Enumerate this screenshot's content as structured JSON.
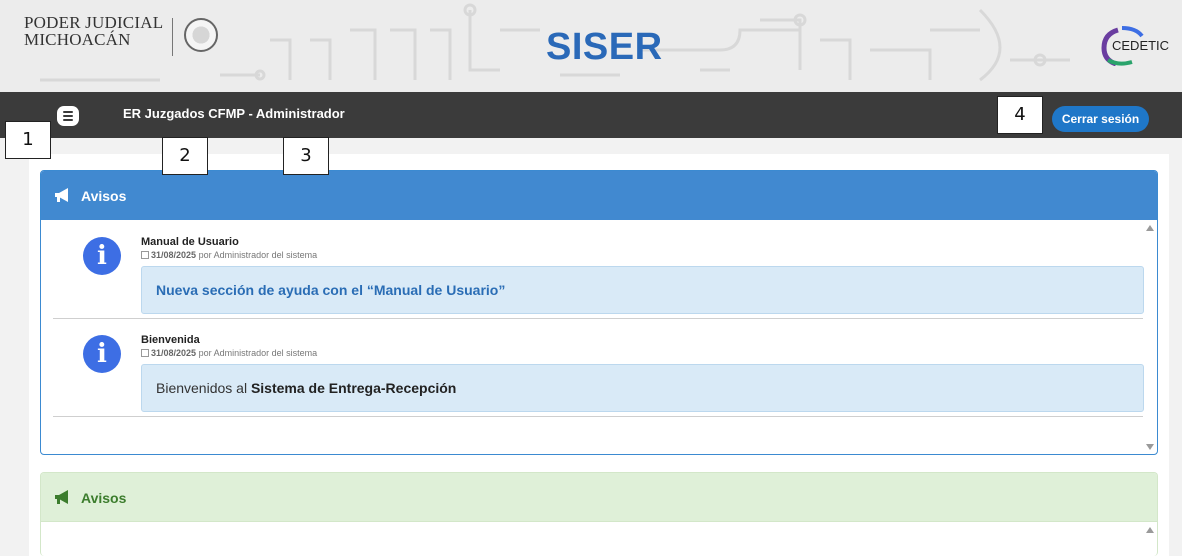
{
  "header": {
    "org_line1": "PODER JUDICIAL",
    "org_line2": "MICHOACÁN",
    "app_title": "SISER",
    "partner_logo": "CEDETIC"
  },
  "navbar": {
    "menu_icon": "menu-icon",
    "title": "ER Juzgados CFMP - Administrador",
    "logout_label": "Cerrar sesión",
    "background": "#3b3b3b",
    "accent": "#1f77c8"
  },
  "callouts": [
    "1",
    "2",
    "3",
    "4"
  ],
  "panels": [
    {
      "title": "Avisos",
      "icon": "megaphone-icon",
      "color": "#4189d0",
      "notices": [
        {
          "title": "Manual de Usuario",
          "date": "31/08/2025",
          "author": "por Administrador del sistema",
          "body": "Nueva sección de ayuda con el “Manual de Usuario”"
        },
        {
          "title": "Bienvenida",
          "date": "31/08/2025",
          "author": "por Administrador del sistema",
          "body_prefix": "Bienvenidos al",
          "body_bold": "Sistema de Entrega-Recepción"
        }
      ]
    },
    {
      "title": "Avisos",
      "icon": "megaphone-icon",
      "color": "#dff0d8"
    }
  ]
}
